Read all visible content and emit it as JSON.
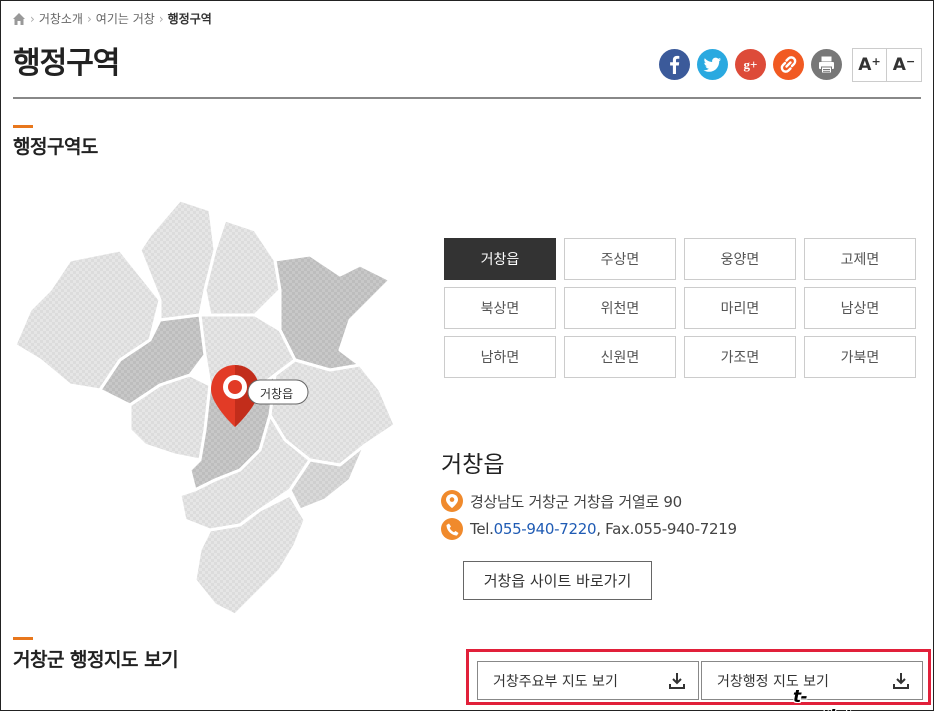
{
  "breadcrumb": {
    "items": [
      "거창소개",
      "여기는 거창"
    ],
    "current": "행정구역"
  },
  "page": {
    "title": "행정구역"
  },
  "share": {
    "facebook": {
      "glyph": "f",
      "color": "#3b5a9a"
    },
    "twitter": {
      "glyph": "t",
      "color": "#2aa9e0"
    },
    "google": {
      "glyph": "g+",
      "color": "#dd4b39"
    },
    "link": {
      "glyph": "🔗",
      "color": "#f15a22"
    },
    "print": {
      "glyph": "🖶",
      "color": "#777777"
    }
  },
  "font_size": {
    "increase": "A",
    "increase_sup": "+",
    "decrease": "A",
    "decrease_sup": "−"
  },
  "section1": {
    "title": "행정구역도"
  },
  "map": {
    "pin_label": "거창읍"
  },
  "districts": [
    {
      "label": "거창읍",
      "active": true
    },
    {
      "label": "주상면",
      "active": false
    },
    {
      "label": "웅양면",
      "active": false
    },
    {
      "label": "고제면",
      "active": false
    },
    {
      "label": "북상면",
      "active": false
    },
    {
      "label": "위천면",
      "active": false
    },
    {
      "label": "마리면",
      "active": false
    },
    {
      "label": "남상면",
      "active": false
    },
    {
      "label": "남하면",
      "active": false
    },
    {
      "label": "신원면",
      "active": false
    },
    {
      "label": "가조면",
      "active": false
    },
    {
      "label": "가북면",
      "active": false
    }
  ],
  "info": {
    "name": "거창읍",
    "address": "경상남도 거창군 거창읍 거열로 90",
    "tel_label": "Tel.",
    "tel": "055-940-7220",
    "fax_label": ", Fax.",
    "fax": "055-940-7219",
    "site_button": "거창읍 사이트 바로가기"
  },
  "section2": {
    "title": "거창군 행정지도 보기"
  },
  "downloads": {
    "btn1": "거창주요부 지도 보기",
    "btn2": "거창행정 지도 보기"
  },
  "watermark": "t-on.tistory.com",
  "colors": {
    "accent": "#e8771c",
    "highlight": "#e1203a",
    "active_cell": "#333333",
    "tel_link": "#1f5bb4"
  }
}
